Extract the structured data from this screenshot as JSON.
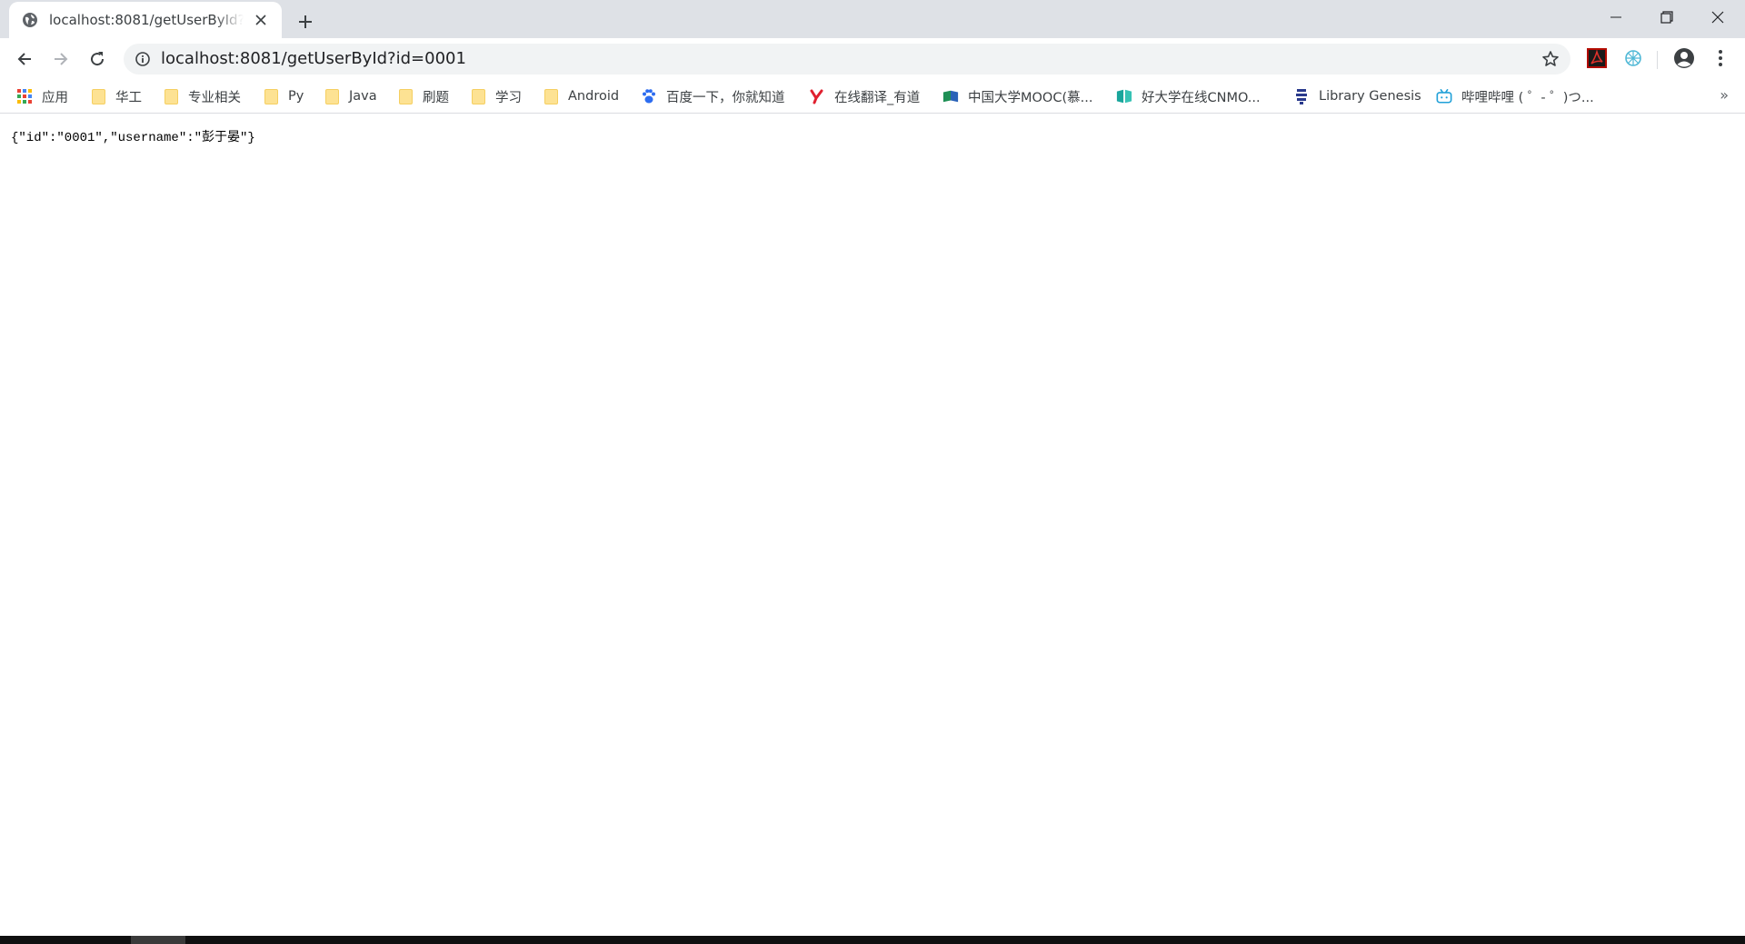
{
  "tab": {
    "title": "localhost:8081/getUserById?id=0001"
  },
  "toolbar": {
    "url": "localhost:8081/getUserById?id=0001"
  },
  "bookmarks": [
    {
      "label": "应用",
      "icon": "apps-grid-icon"
    },
    {
      "label": "华工",
      "icon": "folder-icon"
    },
    {
      "label": "专业相关",
      "icon": "folder-icon"
    },
    {
      "label": "Py",
      "icon": "folder-icon"
    },
    {
      "label": "Java",
      "icon": "folder-icon"
    },
    {
      "label": "刷题",
      "icon": "folder-icon"
    },
    {
      "label": "学习",
      "icon": "folder-icon"
    },
    {
      "label": "Android",
      "icon": "folder-icon"
    },
    {
      "label": "百度一下，你就知道",
      "icon": "baidu-paw-icon"
    },
    {
      "label": "在线翻译_有道",
      "icon": "youdao-icon"
    },
    {
      "label": "中国大学MOOC(慕...",
      "icon": "mooc-icon"
    },
    {
      "label": "好大学在线CNMO...",
      "icon": "book-icon"
    },
    {
      "label": "Library Genesis",
      "icon": "libgen-icon"
    },
    {
      "label": "哔哩哔哩 ( ゜- ゜)つ...",
      "icon": "bilibili-icon"
    }
  ],
  "bookmarks_overflow": "»",
  "page": {
    "body_text": "{\"id\":\"0001\",\"username\":\"彭于晏\"}"
  },
  "colors": {
    "tabstrip": "#dee1e6",
    "omnibox": "#f1f3f4",
    "folder": "#fde293"
  }
}
